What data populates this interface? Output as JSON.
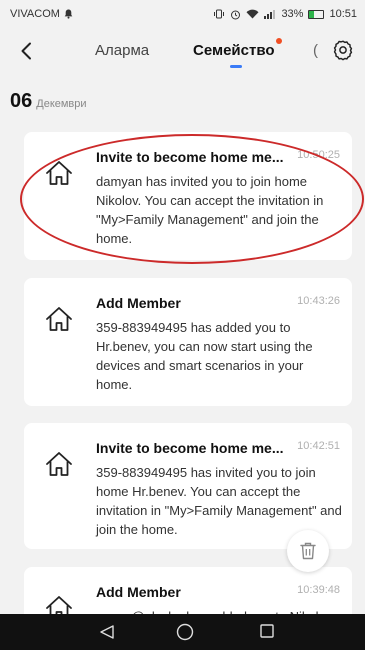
{
  "status_bar": {
    "carrier": "VIVACOM",
    "battery": "33%",
    "battery_level": 0.33,
    "time": "10:51"
  },
  "nav": {
    "tabs": [
      {
        "label": "Аларма"
      },
      {
        "label": "Семейство"
      }
    ],
    "partial_tab_glyph": "("
  },
  "date_group": {
    "day": "06",
    "month": "Декември"
  },
  "messages": [
    {
      "title": "Invite to become home me...",
      "time": "10:50:25",
      "body": "damyan has invited you to join home Nikolov. You can accept the invitation in \"My>Family Management\" and join the home."
    },
    {
      "title": "Add Member",
      "time": "10:43:26",
      "body": "359-883949495 has added you to Hr.benev, you can now start using the devices and smart scenarios in your home."
    },
    {
      "title": "Invite to become home me...",
      "time": "10:42:51",
      "body": "359-883949495 has invited you to join home Hr.benev. You can accept the invitation in \"My>Family Management\" and join the home."
    },
    {
      "title": "Add Member",
      "time": "10:39:48",
      "body": "panyo@abv.bg has added you to Nikolov"
    }
  ],
  "icons": {
    "back": "chevron-left-icon",
    "settings": "gear-icon",
    "message": "home-icon",
    "delete": "trash-icon"
  },
  "colors": {
    "accent": "#3a7bf7",
    "badge": "#f04e23",
    "highlight": "#cc2a2a",
    "battery": "#2db34a"
  }
}
